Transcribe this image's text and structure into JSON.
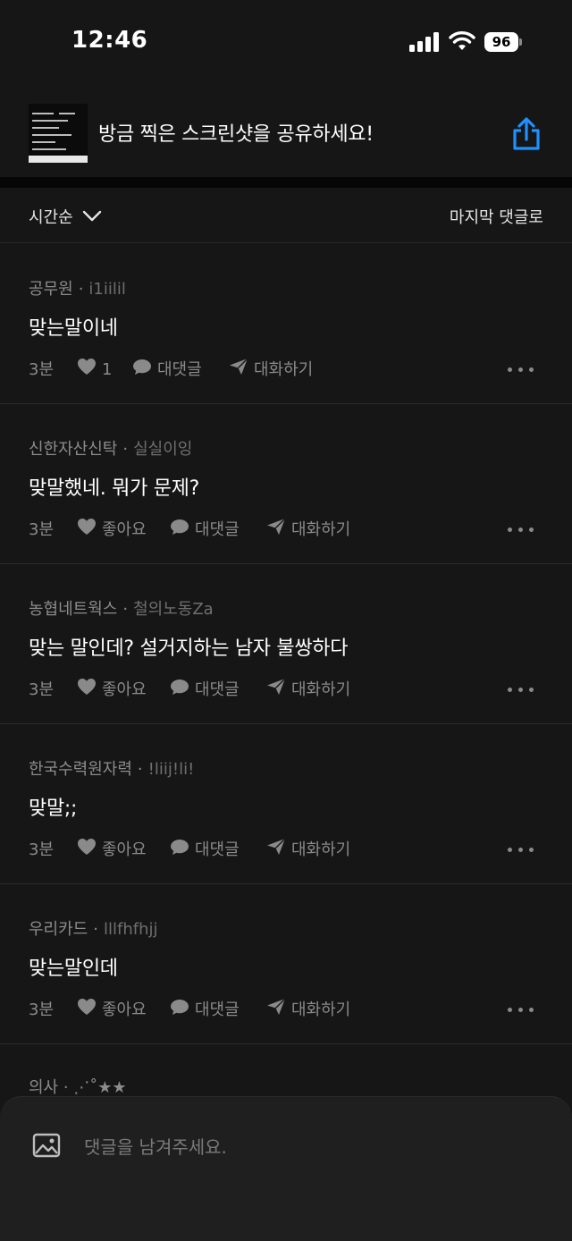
{
  "status_bar": {
    "time": "12:46",
    "battery": "96"
  },
  "share_banner": {
    "title": "방금 찍은 스크린샷을 공유하세요!"
  },
  "sort_bar": {
    "sort_label": "시간순",
    "jump_label": "마지막 댓글로"
  },
  "comments": [
    {
      "company": "공무원",
      "nickname": "i1iilil",
      "text": "맞는말이네",
      "time": "3분",
      "like_label": "1",
      "reply_label": "대댓글",
      "chat_label": "대화하기"
    },
    {
      "company": "신한자산신탁",
      "nickname": "실실이잉",
      "text": "맞말했네. 뭐가 문제?",
      "time": "3분",
      "like_label": "좋아요",
      "reply_label": "대댓글",
      "chat_label": "대화하기"
    },
    {
      "company": "농협네트웍스",
      "nickname": "철의노동Za",
      "text": "맞는 말인데? 설거지하는 남자 불쌍하다",
      "time": "3분",
      "like_label": "좋아요",
      "reply_label": "대댓글",
      "chat_label": "대화하기"
    },
    {
      "company": "한국수력원자력",
      "nickname": "!liij!li!",
      "text": "맞말;;",
      "time": "3분",
      "like_label": "좋아요",
      "reply_label": "대댓글",
      "chat_label": "대화하기"
    },
    {
      "company": "우리카드",
      "nickname": "lllfhfhjj",
      "text": "맞는말인데",
      "time": "3분",
      "like_label": "좋아요",
      "reply_label": "대댓글",
      "chat_label": "대화하기"
    }
  ],
  "partial_comment": {
    "company": "의사",
    "nickname": "⋰˚★★"
  },
  "input_bar": {
    "placeholder": "댓글을 남겨주세요."
  },
  "colors": {
    "accent": "#1e90ff",
    "background": "#161616",
    "muted": "#8a8a8a"
  }
}
